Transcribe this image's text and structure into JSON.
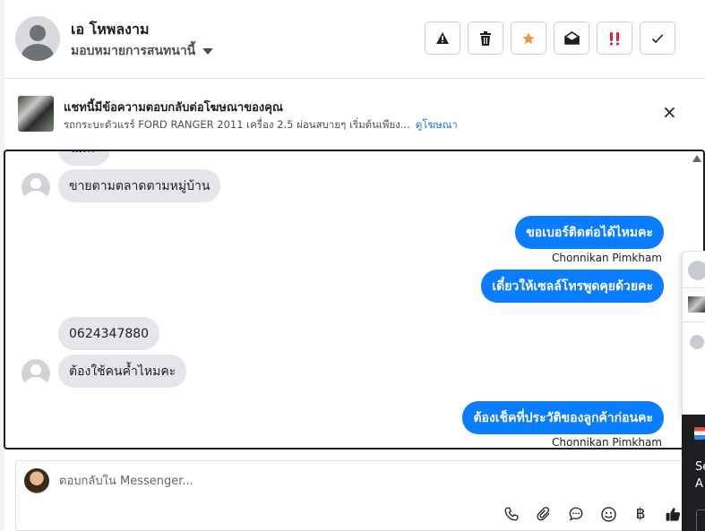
{
  "header": {
    "contact_name": "เอ โหพลงาม",
    "assign_label": "มอบหมายการสนทนานี้",
    "toolbar": [
      {
        "name": "warning-button",
        "icon": "warning-icon"
      },
      {
        "name": "delete-button",
        "icon": "trash-icon"
      },
      {
        "name": "star-button",
        "icon": "star-icon"
      },
      {
        "name": "mark-unread-button",
        "icon": "envelope-open-icon"
      },
      {
        "name": "important-button",
        "icon": "double-exclamation-icon"
      },
      {
        "name": "done-button",
        "icon": "check-icon"
      }
    ]
  },
  "ad_banner": {
    "title": "แชทนี้มีข้อความตอบกลับต่อโฆษณาของคุณ",
    "description": "รถกระบะตัวแรร์ FORD RANGER 2011 เครื่อง 2.5 ผ่อนสบายๆ เริ่มต้นเพียง...",
    "link": "ดูโฆษณา",
    "close": "×"
  },
  "messages": [
    {
      "direction": "in",
      "text": "ไม่ค่ะ",
      "clipped": true
    },
    {
      "direction": "in",
      "text": "ขายตามตลาดตามหมู่บ้าน"
    },
    {
      "direction": "out",
      "text": "ขอเบอร์ติดต่อได้ไหมคะ",
      "sender": "Chonnikan Pimkham"
    },
    {
      "direction": "out",
      "text": "เดี๋ยวให้เซลล์โทรพูดคุยด้วยคะ"
    },
    {
      "direction": "in",
      "text": "0624347880"
    },
    {
      "direction": "in",
      "text": "ต้องใช้คนค้ำไหมคะ"
    },
    {
      "direction": "out",
      "text": "ต้องเช็คที่ประวัติของลูกค้าก่อนคะ",
      "sender": "Chonnikan Pimkham"
    }
  ],
  "reply": {
    "placeholder": "ตอบกลับใน Messenger...",
    "tools": [
      "phone-icon",
      "paperclip-icon",
      "saved-replies-icon",
      "emoji-icon",
      "baht-icon",
      "thumbs-up-icon"
    ],
    "baht_symbol": "฿"
  },
  "side_panel": {
    "text_line1": "Se",
    "text_line2": "A"
  },
  "colors": {
    "outgoing_bubble": "#0a7cff",
    "incoming_bubble": "#e4e6eb",
    "link": "#216fdb",
    "star": "#f7923b",
    "important": "#e41e3f"
  }
}
